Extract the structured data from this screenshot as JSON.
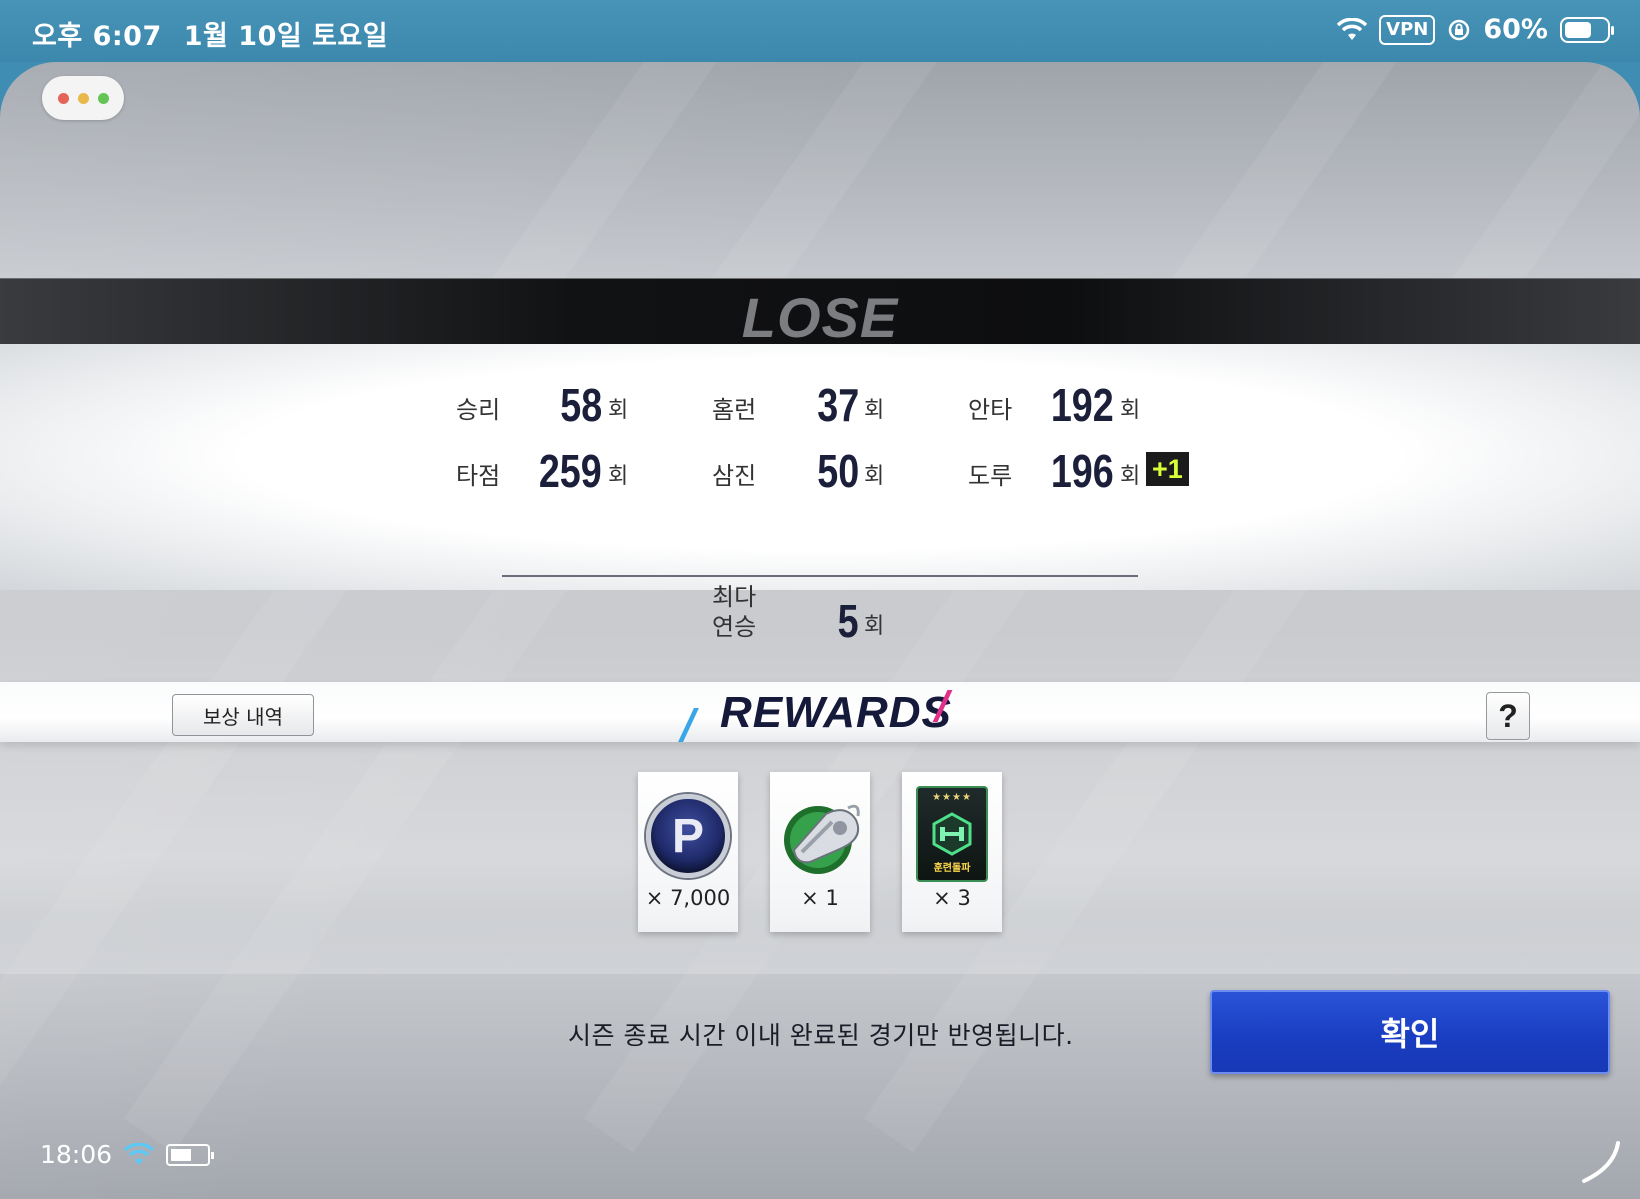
{
  "status_bar": {
    "time": "오후 6:07",
    "date": "1월 10일 토요일",
    "vpn_label": "VPN",
    "battery_percent": "60%"
  },
  "window_controls": {
    "colors": [
      "#e5645a",
      "#e8b84a",
      "#62c554"
    ]
  },
  "result": {
    "banner_text": "LOSE"
  },
  "stats": {
    "wins": {
      "label": "승리",
      "value": "58",
      "unit": "회"
    },
    "homeruns": {
      "label": "홈런",
      "value": "37",
      "unit": "회"
    },
    "hits": {
      "label": "안타",
      "value": "192",
      "unit": "회"
    },
    "rbi": {
      "label": "타점",
      "value": "259",
      "unit": "회"
    },
    "strikeouts": {
      "label": "삼진",
      "value": "50",
      "unit": "회"
    },
    "steals": {
      "label": "도루",
      "value": "196",
      "unit": "회",
      "increment": "+1"
    },
    "max_streak": {
      "label_line1": "최다",
      "label_line2": "연승",
      "value": "5",
      "unit": "회"
    }
  },
  "rewards": {
    "title": "REWARDS",
    "history_button": "보상 내역",
    "help_button": "?",
    "items": [
      {
        "icon": "points-coin-icon",
        "icon_text": "P",
        "quantity": "× 7,000"
      },
      {
        "icon": "whistle-icon",
        "quantity": "× 1"
      },
      {
        "icon": "training-card-icon",
        "card_stars": "★★★★",
        "card_label": "훈련돌파",
        "quantity": "× 3"
      }
    ]
  },
  "footer": {
    "notice": "시즌 종료 시간 이내 완료된 경기만 반영됩니다.",
    "confirm_button": "확인"
  },
  "device_status": {
    "time": "18:06"
  },
  "colors": {
    "confirm_blue": "#1a3ec2",
    "stat_value_navy": "#1b1f3a",
    "increment_green": "#d9ff3a",
    "accent_blue": "#3aa6e8",
    "accent_pink": "#e0308a"
  }
}
